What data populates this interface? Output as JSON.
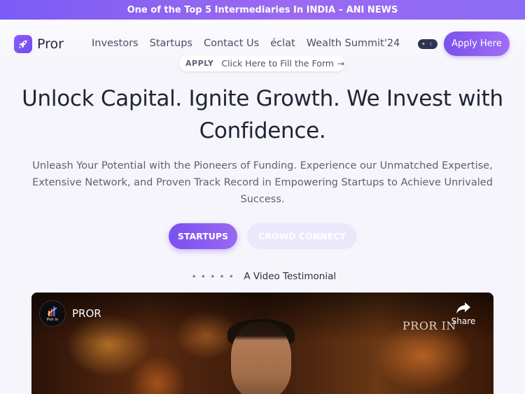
{
  "announcement": {
    "text": "One of the Top 5 Intermediaries In INDIA – ANI NEWS"
  },
  "header": {
    "logo_text": "Pror",
    "nav": [
      {
        "label": "Investors"
      },
      {
        "label": "Startups"
      },
      {
        "label": "Contact Us"
      },
      {
        "label": "éclat"
      },
      {
        "label": "Wealth Summit'24"
      }
    ],
    "theme_toggle": {
      "state": "dark"
    },
    "apply_label": "Apply Here"
  },
  "apply_pill": {
    "tag": "APPLY",
    "text": "Click Here to Fill the Form",
    "arrow": "→"
  },
  "hero": {
    "title_line1": "Unlock Capital. Ignite Growth. We Invest with",
    "title_line2": "Confidence.",
    "subtitle": "Unleash Your Potential with the Pioneers of Funding. Experience our Unmatched Expertise, Extensive Network, and Proven Track Record in Empowering Startups to Achieve Unrivaled Success."
  },
  "cta": {
    "primary": "STARTUPS",
    "secondary": "CROWD CONNECT"
  },
  "testimonial": {
    "stars": [
      "★",
      "★",
      "★",
      "★",
      "★"
    ],
    "label": "A Video Testimonial"
  },
  "video": {
    "channel_caption": "Pror In",
    "title": "PROR",
    "watermark": "PROR IN",
    "share_label": "Share"
  },
  "colors": {
    "accent": "#7a51ee",
    "accent_light": "#ebe8fc",
    "background": "#f5f5fb",
    "text_dark": "#1f2437"
  }
}
